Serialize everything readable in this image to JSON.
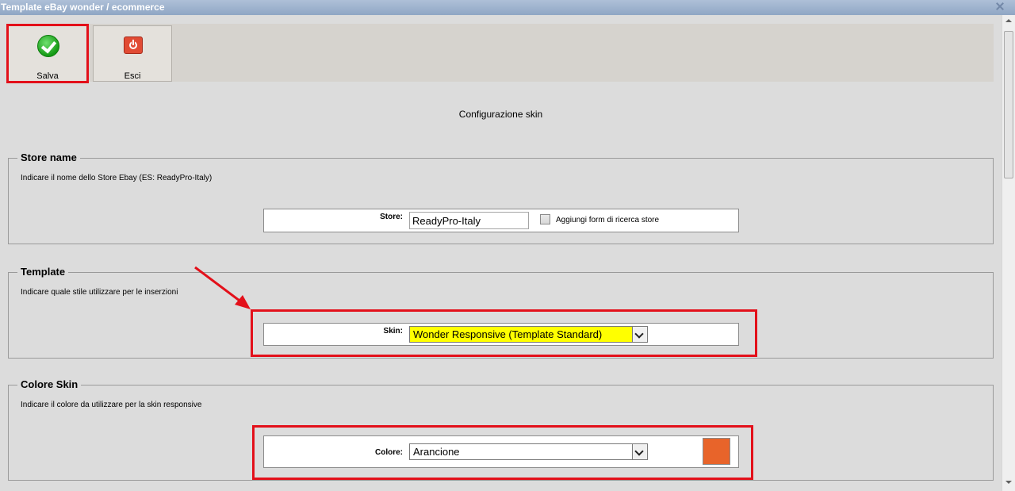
{
  "window": {
    "title": "Template eBay wonder / ecommerce"
  },
  "toolbar": {
    "save_label": "Salva",
    "exit_label": "Esci"
  },
  "page": {
    "heading": "Configurazione skin"
  },
  "store_section": {
    "legend": "Store name",
    "description": "Indicare il nome dello Store Ebay (ES: ReadyPro-Italy)",
    "store_label": "Store:",
    "store_value": "ReadyPro-Italy",
    "search_checkbox_label": "Aggiungi form di ricerca store",
    "search_checkbox_checked": false
  },
  "template_section": {
    "legend": "Template",
    "description": "Indicare quale stile utilizzare per le inserzioni",
    "skin_label": "Skin:",
    "skin_value": "Wonder Responsive (Template Standard)"
  },
  "color_section": {
    "legend": "Colore Skin",
    "description": "Indicare il colore da utilizzare per la skin responsive",
    "color_label": "Colore:",
    "color_value": "Arancione",
    "swatch_color": "#e8642a"
  },
  "colors": {
    "highlight": "#e3101a",
    "skin_select_bg": "#ffff00"
  }
}
